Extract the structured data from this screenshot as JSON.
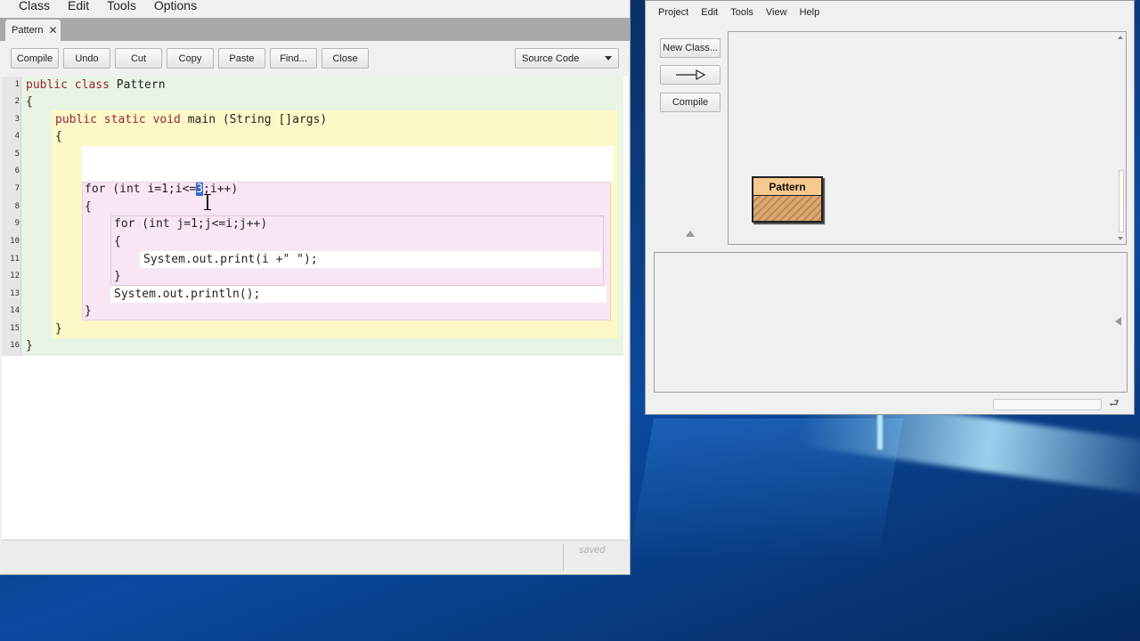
{
  "editor": {
    "menu": [
      "Class",
      "Edit",
      "Tools",
      "Options"
    ],
    "tab": {
      "label": "Pattern",
      "close": "✕"
    },
    "toolbar": {
      "compile": "Compile",
      "undo": "Undo",
      "cut": "Cut",
      "copy": "Copy",
      "paste": "Paste",
      "find": "Find...",
      "close": "Close",
      "view_selected": "Source Code"
    },
    "line_numbers": [
      "1",
      "2",
      "3",
      "4",
      "5",
      "6",
      "7",
      "8",
      "9",
      "10",
      "11",
      "12",
      "13",
      "14",
      "15",
      "16"
    ],
    "code": {
      "l1_kw": "public class",
      "l1_rest": " Pattern",
      "l2": "{",
      "l3_kw": "public static void",
      "l3_rest": " main (String []args)",
      "l4": "{",
      "l7_a": "for (int i=1;i<=",
      "l7_sel": "3",
      "l7_b": ";i++)",
      "l8": "{",
      "l9": "for (int j=1;j<=i;j++)",
      "l10": "{",
      "l11": "System.out.print(i +\" \");",
      "l12": "}",
      "l13": "System.out.println();",
      "l14": "}",
      "l15": "}",
      "l16": "}"
    },
    "status": "saved"
  },
  "project": {
    "menu": [
      "Project",
      "Edit",
      "Tools",
      "View",
      "Help"
    ],
    "buttons": {
      "new_class": "New Class...",
      "arrow": "→",
      "compile": "Compile"
    },
    "class_box": {
      "name": "Pattern"
    },
    "colors": {
      "class_fill": "#f6c98f",
      "class_hatch": "#c08550"
    }
  },
  "colors": {
    "class_scope": "#e8f5e4",
    "method_scope": "#fdf8c8",
    "loop_scope": "#f9e6f4",
    "keyword": "#9b2233",
    "selection": "#3366cc"
  }
}
